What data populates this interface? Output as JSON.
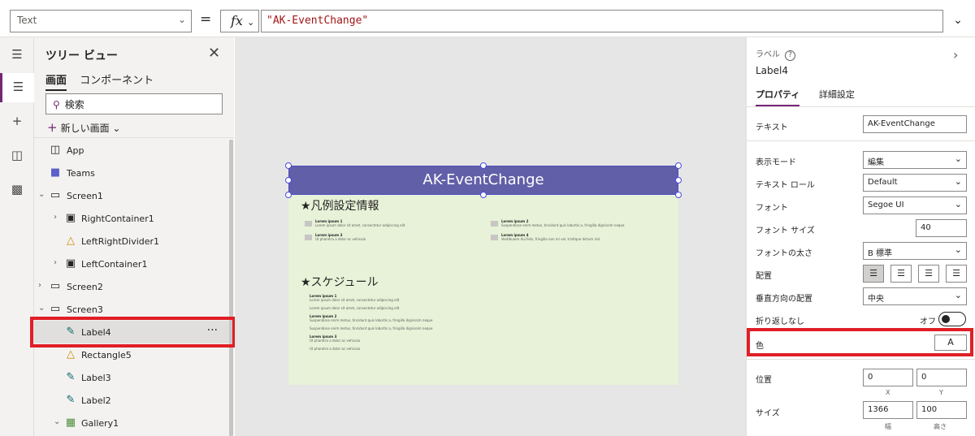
{
  "formula_bar": {
    "property": "Text",
    "equals": "=",
    "fx": "fx",
    "formula": "\"AK-EventChange\""
  },
  "tree": {
    "title": "ツリー ビュー",
    "tabs": [
      "画面",
      "コンポーネント"
    ],
    "search_placeholder": "検索",
    "new_screen": "新しい画面",
    "nodes": [
      {
        "label": "App"
      },
      {
        "label": "Teams"
      },
      {
        "label": "Screen1"
      },
      {
        "label": "RightContainer1"
      },
      {
        "label": "LeftRightDivider1"
      },
      {
        "label": "LeftContainer1"
      },
      {
        "label": "Screen2"
      },
      {
        "label": "Screen3"
      },
      {
        "label": "Label4"
      },
      {
        "label": "Rectangle5"
      },
      {
        "label": "Label3"
      },
      {
        "label": "Label2"
      },
      {
        "label": "Gallery1"
      }
    ],
    "more": "···"
  },
  "canvas": {
    "header_text": "AK-EventChange",
    "section1_title": "★凡例設定情報",
    "section2_title": "★スケジュール",
    "legend_items": [
      {
        "title": "Lorem ipsum 1",
        "body": "Lorem ipsum dolor sit amet, consectetur adipiscing elit"
      },
      {
        "title": "Lorem ipsum 2",
        "body": "Suspendisse enim metus, tincidunt quis lobortis a, fringilla dignissim neque"
      },
      {
        "title": "Lorem ipsum 3",
        "body": "Ut pharetra a dolor ac vehicula"
      },
      {
        "title": "Lorem ipsum 4",
        "body": "Vestibulum dui felis, fringilla non mi vel, tristique dictum nisl"
      }
    ],
    "schedule_items": [
      {
        "title": "Lorem ipsum 1",
        "line1": "Lorem ipsum dolor sit amet, consectetur adipiscing elit",
        "line2": "Lorem ipsum dolor sit amet, consectetur adipiscing elit"
      },
      {
        "title": "Lorem ipsum 2",
        "line1": "Suspendisse enim metus, tincidunt quis lobortis a, fringilla dignissim neque",
        "line2": "Suspendisse enim metus, tincidunt quis lobortis a, fringilla dignissim neque"
      },
      {
        "title": "Lorem ipsum 3",
        "line1": "Ut pharetra a dolor ac vehicula",
        "line2": "Ut pharetra a dolor ac vehicula"
      }
    ]
  },
  "props": {
    "kind": "ラベル",
    "name": "Label4",
    "tabs": [
      "プロパティ",
      "詳細設定"
    ],
    "text_label": "テキスト",
    "text_value": "AK-EventChange",
    "display_mode_label": "表示モード",
    "display_mode_value": "編集",
    "text_role_label": "テキスト ロール",
    "text_role_value": "Default",
    "font_label": "フォント",
    "font_value": "Segoe UI",
    "font_size_label": "フォント サイズ",
    "font_size_value": "40",
    "font_weight_label": "フォントの太さ",
    "font_weight_value": "B  標準",
    "align_label": "配置",
    "valign_label": "垂直方向の配置",
    "valign_value": "中央",
    "wrap_label": "折り返しなし",
    "wrap_state": "オフ",
    "color_label": "色",
    "color_value": "A",
    "position_label": "位置",
    "pos_x": "0",
    "pos_y": "0",
    "x_label": "X",
    "y_label": "Y",
    "size_label": "サイズ",
    "width": "1366",
    "height": "100",
    "width_label": "幅",
    "height_label": "高さ"
  },
  "colors": {
    "accent": "#742774",
    "header_fill": "#605fa8",
    "screen_fill": "#e7f2d8",
    "highlight": "#e01e26"
  }
}
